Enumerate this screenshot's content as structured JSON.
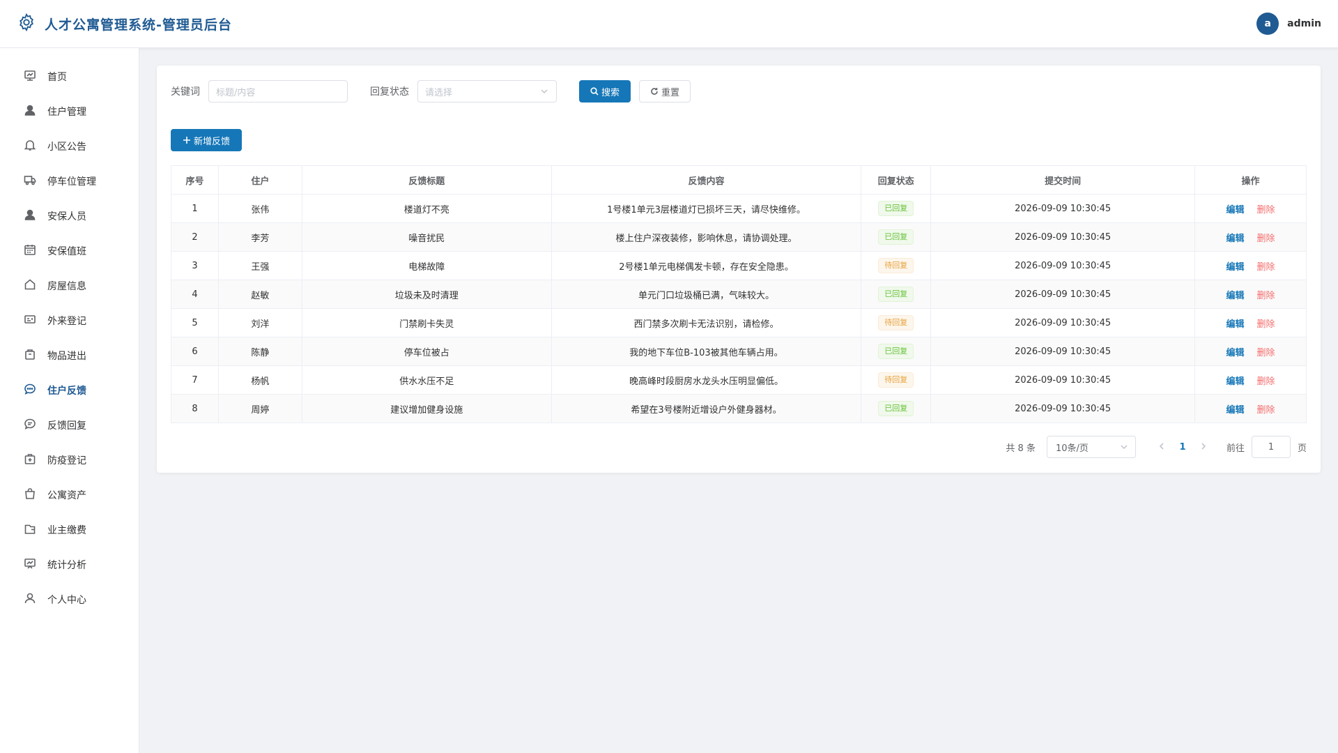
{
  "header": {
    "title": "人才公寓管理系统-管理员后台",
    "avatar_letter": "a",
    "username": "admin"
  },
  "sidebar": {
    "items": [
      {
        "label": "首页",
        "icon": "monitor-icon"
      },
      {
        "label": "住户管理",
        "icon": "user-filled-icon"
      },
      {
        "label": "小区公告",
        "icon": "bell-icon"
      },
      {
        "label": "停车位管理",
        "icon": "truck-icon"
      },
      {
        "label": "安保人员",
        "icon": "user-filled-icon"
      },
      {
        "label": "安保值班",
        "icon": "calendar-icon"
      },
      {
        "label": "房屋信息",
        "icon": "house-icon"
      },
      {
        "label": "外来登记",
        "icon": "postcard-icon"
      },
      {
        "label": "物品进出",
        "icon": "box-icon"
      },
      {
        "label": "住户反馈",
        "icon": "chat-icon",
        "active": true
      },
      {
        "label": "反馈回复",
        "icon": "chat-line-icon"
      },
      {
        "label": "防疫登记",
        "icon": "first-aid-icon"
      },
      {
        "label": "公寓资产",
        "icon": "bag-icon"
      },
      {
        "label": "业主缴费",
        "icon": "wallet-icon"
      },
      {
        "label": "统计分析",
        "icon": "data-board-icon"
      },
      {
        "label": "个人中心",
        "icon": "user-icon"
      }
    ]
  },
  "filters": {
    "keyword_label": "关键词",
    "keyword_placeholder": "标题/内容",
    "status_label": "回复状态",
    "status_placeholder": "请选择",
    "search_label": "搜索",
    "reset_label": "重置"
  },
  "add_button_label": "新增反馈",
  "table": {
    "headers": [
      "序号",
      "住户",
      "反馈标题",
      "反馈内容",
      "回复状态",
      "提交时间",
      "操作"
    ],
    "rows": [
      {
        "no": "1",
        "resident": "张伟",
        "title": "楼道灯不亮",
        "content": "1号楼1单元3层楼道灯已损坏三天，请尽快维修。",
        "status": "已回复",
        "status_type": "ok",
        "time": "2026-09-09 10:30:45"
      },
      {
        "no": "2",
        "resident": "李芳",
        "title": "噪音扰民",
        "content": "楼上住户深夜装修，影响休息，请协调处理。",
        "status": "已回复",
        "status_type": "ok",
        "time": "2026-09-09 10:30:45"
      },
      {
        "no": "3",
        "resident": "王强",
        "title": "电梯故障",
        "content": "2号楼1单元电梯偶发卡顿，存在安全隐患。",
        "status": "待回复",
        "status_type": "wait",
        "time": "2026-09-09 10:30:45"
      },
      {
        "no": "4",
        "resident": "赵敏",
        "title": "垃圾未及时清理",
        "content": "单元门口垃圾桶已满，气味较大。",
        "status": "已回复",
        "status_type": "ok",
        "time": "2026-09-09 10:30:45"
      },
      {
        "no": "5",
        "resident": "刘洋",
        "title": "门禁刷卡失灵",
        "content": "西门禁多次刷卡无法识别，请检修。",
        "status": "待回复",
        "status_type": "wait",
        "time": "2026-09-09 10:30:45"
      },
      {
        "no": "6",
        "resident": "陈静",
        "title": "停车位被占",
        "content": "我的地下车位B-103被其他车辆占用。",
        "status": "已回复",
        "status_type": "ok",
        "time": "2026-09-09 10:30:45"
      },
      {
        "no": "7",
        "resident": "杨帆",
        "title": "供水水压不足",
        "content": "晚高峰时段厨房水龙头水压明显偏低。",
        "status": "待回复",
        "status_type": "wait",
        "time": "2026-09-09 10:30:45"
      },
      {
        "no": "8",
        "resident": "周婷",
        "title": "建议增加健身设施",
        "content": "希望在3号楼附近增设户外健身器材。",
        "status": "已回复",
        "status_type": "ok",
        "time": "2026-09-09 10:30:45"
      }
    ],
    "edit_label": "编辑",
    "delete_label": "删除"
  },
  "pagination": {
    "total_text": "共 8 条",
    "page_size": "10条/页",
    "current_page": "1",
    "goto_label": "前往",
    "goto_value": "1",
    "page_suffix": "页"
  },
  "colors": {
    "primary": "#1677b8",
    "brand": "#1f5a93",
    "success": "#67c23a",
    "warning": "#e6a23c",
    "danger": "#f56c6c"
  }
}
